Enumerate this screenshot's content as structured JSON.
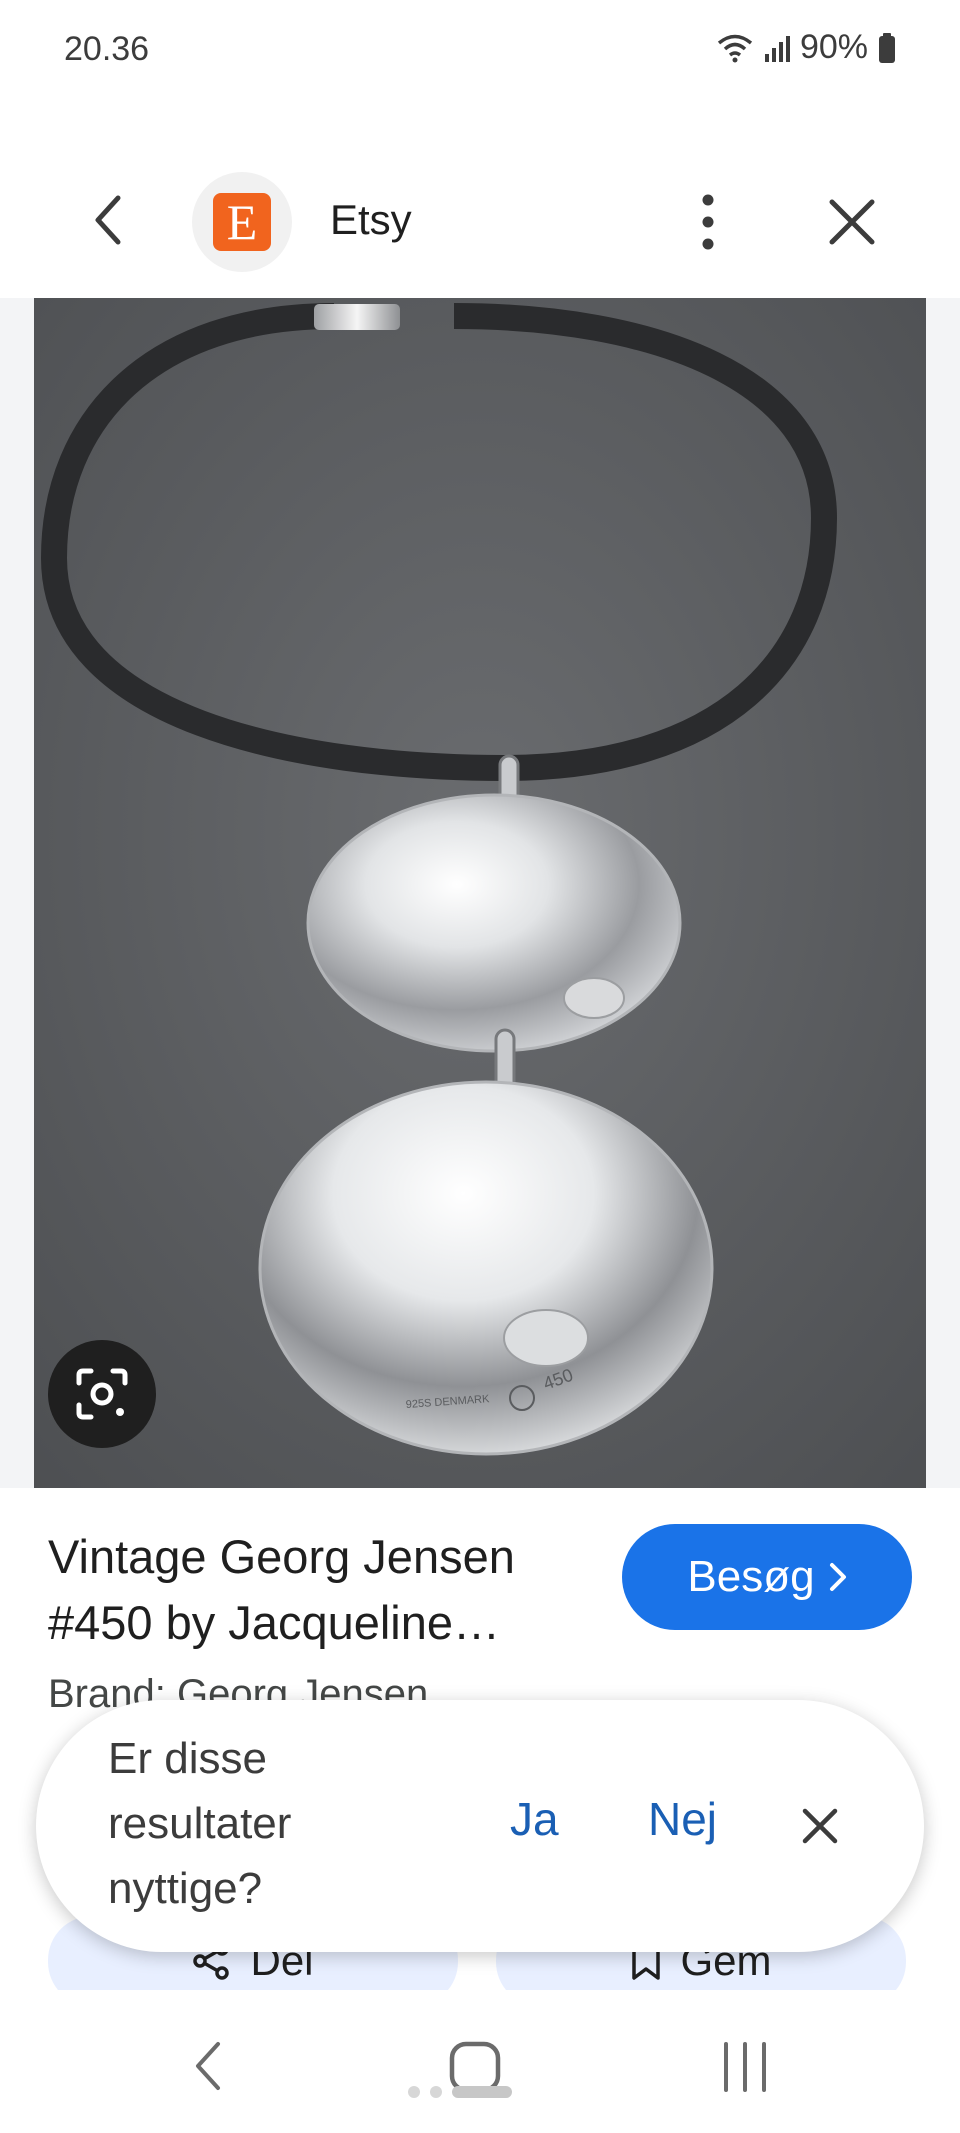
{
  "status_bar": {
    "time": "20.36",
    "battery": "90%"
  },
  "header": {
    "site_name": "Etsy",
    "logo_letter": "E"
  },
  "result": {
    "title": "Vintage Georg Jensen #450 by Jacqueline…",
    "brand": "Brand: Georg Jensen",
    "visit_label": "Besøg"
  },
  "image": {
    "stamp_left": "925S DENMARK",
    "stamp_number": "450"
  },
  "actions": {
    "share_label": "Del",
    "save_label": "Gem"
  },
  "feedback": {
    "question": "Er disse resultater nyttige?",
    "yes_label": "Ja",
    "no_label": "Nej"
  },
  "colors": {
    "accent": "#1a73e8",
    "etsy_orange": "#f1641e",
    "link": "#1a5fb4"
  }
}
